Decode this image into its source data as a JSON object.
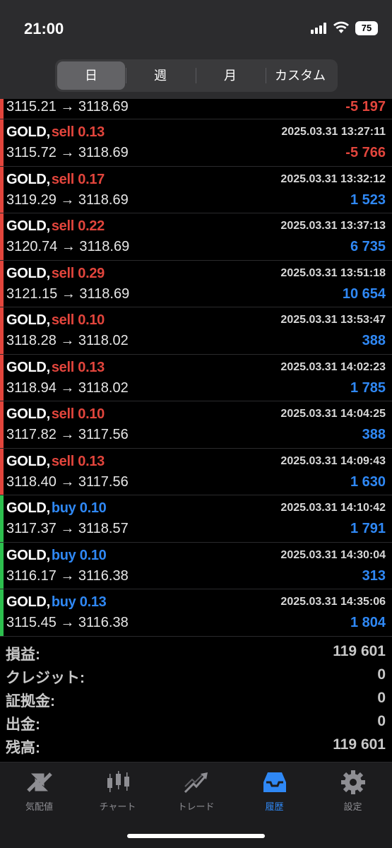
{
  "status": {
    "time": "21:00",
    "battery": "75"
  },
  "segments": [
    {
      "label": "日",
      "active": true
    },
    {
      "label": "週",
      "active": false
    },
    {
      "label": "月",
      "active": false
    },
    {
      "label": "カスタム",
      "active": false
    }
  ],
  "colors": {
    "sell": "#e2453c",
    "buy": "#2f88f5",
    "negative": "#e2453c",
    "positive": "#2f88f5",
    "sell_bar": "#e2453c",
    "buy_bar": "#2dbf4e"
  },
  "partial_row": {
    "prices": "3115.21 → 3118.69",
    "pl": "-5 197",
    "pl_sign": "negative",
    "side": "sell"
  },
  "trades": [
    {
      "symbol": "GOLD,",
      "side": "sell",
      "side_label": "sell 0.13",
      "datetime": "2025.03.31 13:27:11",
      "prices": "3115.72 → 3118.69",
      "pl": "-5 766",
      "pl_sign": "negative"
    },
    {
      "symbol": "GOLD,",
      "side": "sell",
      "side_label": "sell 0.17",
      "datetime": "2025.03.31 13:32:12",
      "prices": "3119.29 → 3118.69",
      "pl": "1 523",
      "pl_sign": "positive"
    },
    {
      "symbol": "GOLD,",
      "side": "sell",
      "side_label": "sell 0.22",
      "datetime": "2025.03.31 13:37:13",
      "prices": "3120.74 → 3118.69",
      "pl": "6 735",
      "pl_sign": "positive"
    },
    {
      "symbol": "GOLD,",
      "side": "sell",
      "side_label": "sell 0.29",
      "datetime": "2025.03.31 13:51:18",
      "prices": "3121.15 → 3118.69",
      "pl": "10 654",
      "pl_sign": "positive"
    },
    {
      "symbol": "GOLD,",
      "side": "sell",
      "side_label": "sell 0.10",
      "datetime": "2025.03.31 13:53:47",
      "prices": "3118.28 → 3118.02",
      "pl": "388",
      "pl_sign": "positive"
    },
    {
      "symbol": "GOLD,",
      "side": "sell",
      "side_label": "sell 0.13",
      "datetime": "2025.03.31 14:02:23",
      "prices": "3118.94 → 3118.02",
      "pl": "1 785",
      "pl_sign": "positive"
    },
    {
      "symbol": "GOLD,",
      "side": "sell",
      "side_label": "sell 0.10",
      "datetime": "2025.03.31 14:04:25",
      "prices": "3117.82 → 3117.56",
      "pl": "388",
      "pl_sign": "positive"
    },
    {
      "symbol": "GOLD,",
      "side": "sell",
      "side_label": "sell 0.13",
      "datetime": "2025.03.31 14:09:43",
      "prices": "3118.40 → 3117.56",
      "pl": "1 630",
      "pl_sign": "positive"
    },
    {
      "symbol": "GOLD,",
      "side": "buy",
      "side_label": "buy 0.10",
      "datetime": "2025.03.31 14:10:42",
      "prices": "3117.37 → 3118.57",
      "pl": "1 791",
      "pl_sign": "positive"
    },
    {
      "symbol": "GOLD,",
      "side": "buy",
      "side_label": "buy 0.10",
      "datetime": "2025.03.31 14:30:04",
      "prices": "3116.17 → 3116.38",
      "pl": "313",
      "pl_sign": "positive"
    },
    {
      "symbol": "GOLD,",
      "side": "buy",
      "side_label": "buy 0.13",
      "datetime": "2025.03.31 14:35:06",
      "prices": "3115.45 → 3116.38",
      "pl": "1 804",
      "pl_sign": "positive"
    }
  ],
  "summary": [
    {
      "label": "損益:",
      "value": "119 601"
    },
    {
      "label": "クレジット:",
      "value": "0"
    },
    {
      "label": "証拠金:",
      "value": "0"
    },
    {
      "label": "出金:",
      "value": "0"
    },
    {
      "label": "残高:",
      "value": "119 601"
    }
  ],
  "tabs": [
    {
      "label": "気配値",
      "icon": "quotes-icon",
      "active": false
    },
    {
      "label": "チャート",
      "icon": "chart-icon",
      "active": false
    },
    {
      "label": "トレード",
      "icon": "trade-icon",
      "active": false
    },
    {
      "label": "履歴",
      "icon": "history-icon",
      "active": true
    },
    {
      "label": "設定",
      "icon": "settings-icon",
      "active": false
    }
  ]
}
